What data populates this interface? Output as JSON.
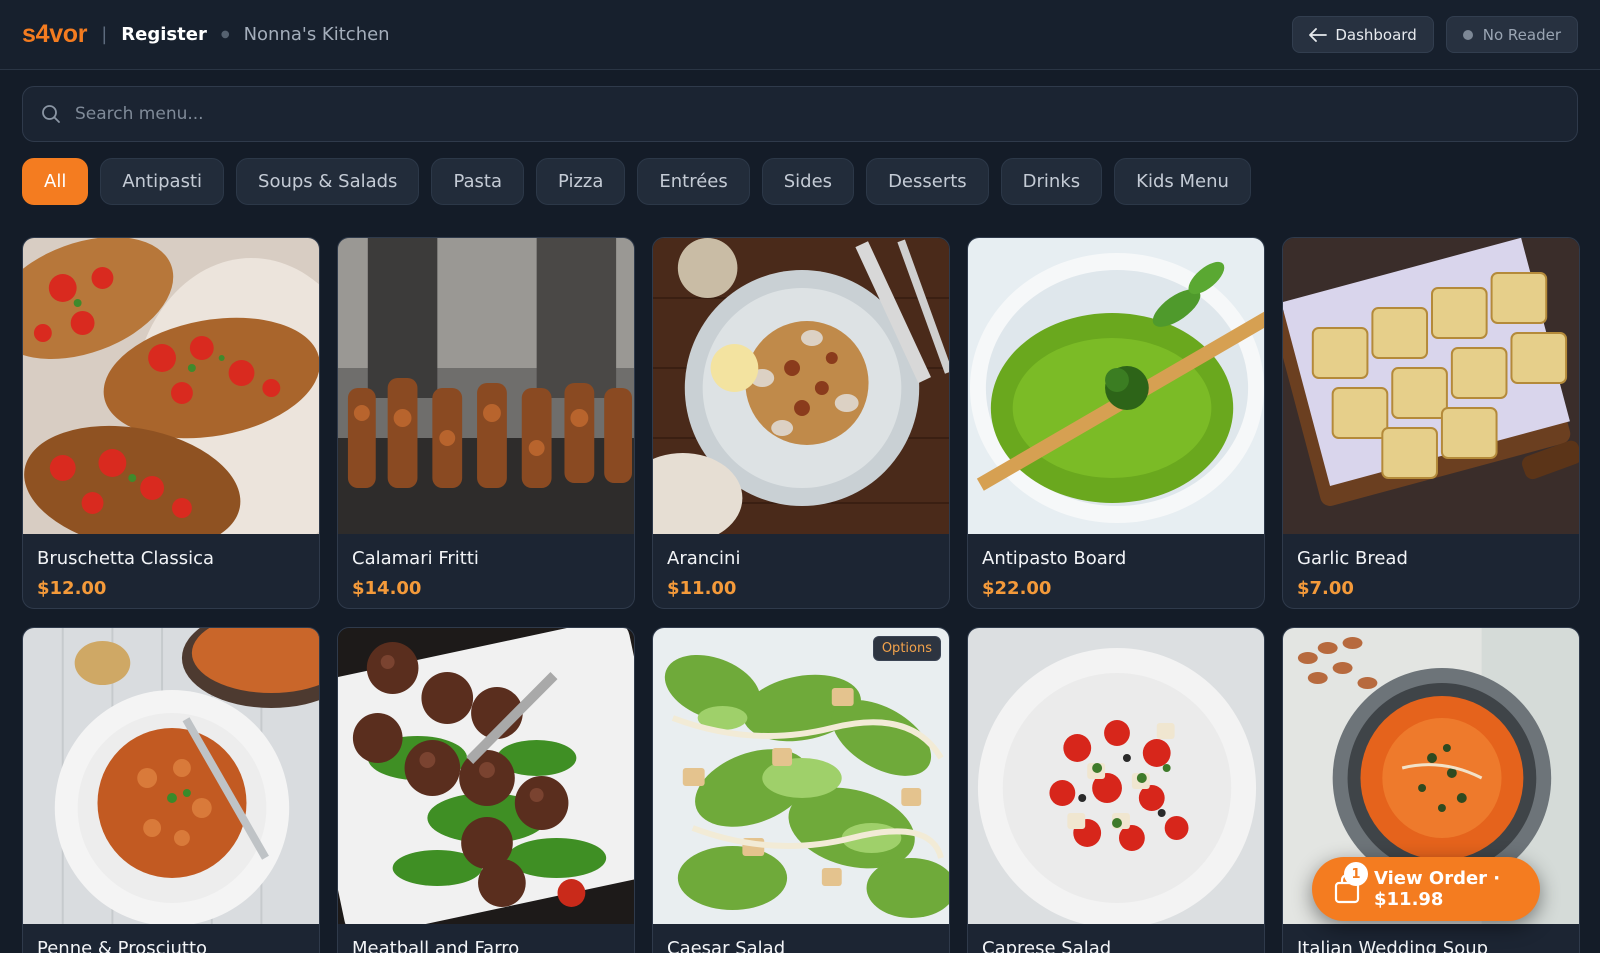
{
  "header": {
    "logo": "s4vor",
    "separator": "|",
    "page": "Register",
    "restaurant": "Nonna's Kitchen",
    "dashboard_label": "Dashboard",
    "reader_label": "No Reader"
  },
  "search": {
    "placeholder": "Search menu..."
  },
  "categories": [
    "All",
    "Antipasti",
    "Soups & Salads",
    "Pasta",
    "Pizza",
    "Entrées",
    "Sides",
    "Desserts",
    "Drinks",
    "Kids Menu"
  ],
  "active_category": "All",
  "items": [
    {
      "name": "Bruschetta Classica",
      "price": "$12.00",
      "image": "bruschetta"
    },
    {
      "name": "Calamari Fritti",
      "price": "$14.00",
      "image": "skewers"
    },
    {
      "name": "Arancini",
      "price": "$11.00",
      "image": "pasta-clams"
    },
    {
      "name": "Antipasto Board",
      "price": "$22.00",
      "image": "green-soup"
    },
    {
      "name": "Garlic Bread",
      "price": "$7.00",
      "image": "garlic-bread"
    },
    {
      "name": "Penne & Prosciutto",
      "price": "",
      "image": "fusilli"
    },
    {
      "name": "Meatball and Farro",
      "price": "",
      "image": "meatballs"
    },
    {
      "name": "Caesar Salad",
      "price": "",
      "image": "caesar-salad",
      "badge": "Options"
    },
    {
      "name": "Caprese Salad",
      "price": "",
      "image": "caprese-salad"
    },
    {
      "name": "Italian Wedding Soup",
      "price": "",
      "image": "tomato-soup"
    }
  ],
  "order": {
    "count": "1",
    "label": "View Order · $11.98"
  },
  "colors": {
    "accent": "#f47c20",
    "background": "#141c28",
    "card": "#1c2533",
    "price": "#f49a3a"
  }
}
